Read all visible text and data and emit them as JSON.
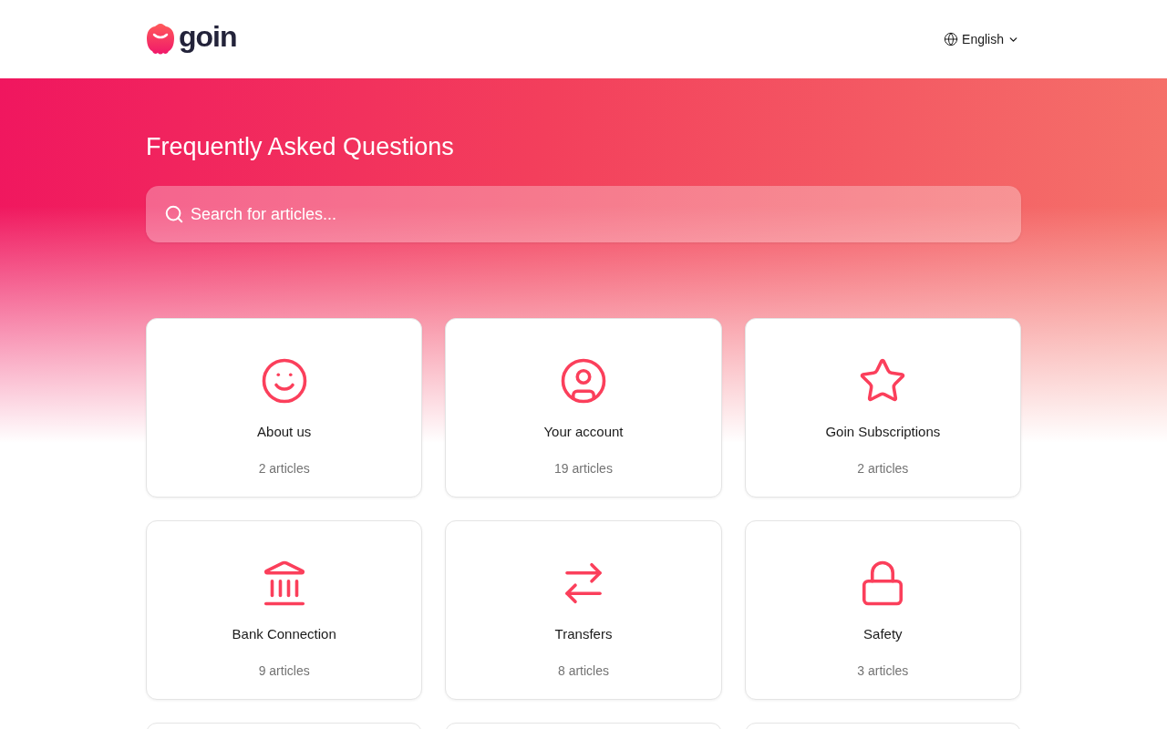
{
  "header": {
    "logo_text": "goin",
    "language": {
      "label": "English"
    }
  },
  "hero": {
    "title": "Frequently Asked Questions",
    "search": {
      "placeholder": "Search for articles..."
    }
  },
  "categories": [
    {
      "kind": "smiley",
      "title": "About us",
      "count": "2 articles"
    },
    {
      "kind": "person",
      "title": "Your account",
      "count": "19 articles"
    },
    {
      "kind": "star",
      "title": "Goin Subscriptions",
      "count": "2 articles"
    },
    {
      "kind": "bank",
      "title": "Bank Connection",
      "count": "9 articles"
    },
    {
      "kind": "arrows",
      "title": "Transfers",
      "count": "8 articles"
    },
    {
      "kind": "lock",
      "title": "Safety",
      "count": "3 articles"
    }
  ]
}
